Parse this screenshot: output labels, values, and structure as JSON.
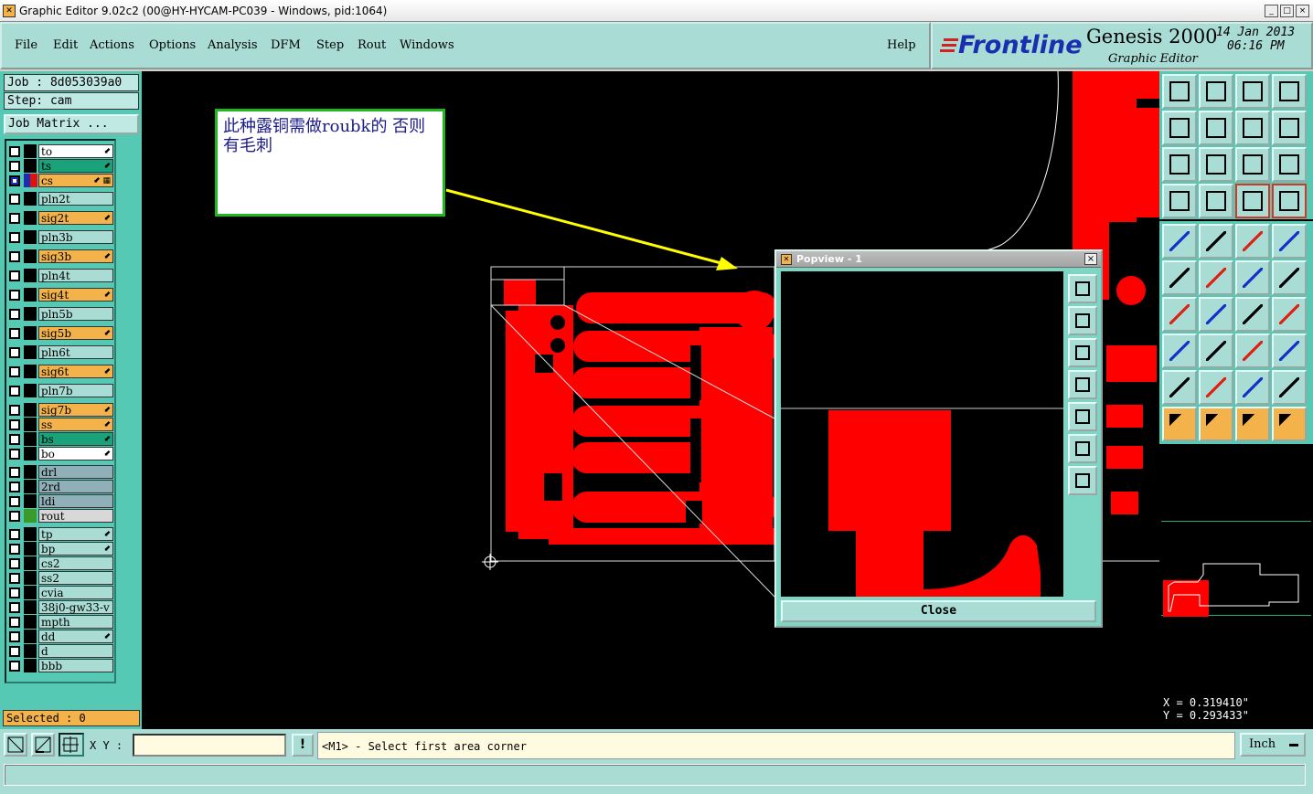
{
  "window": {
    "title": "Graphic Editor 9.02c2 (00@HY-HYCAM-PC039 - Windows, pid:1064)",
    "min": "_",
    "max": "□",
    "close": "×"
  },
  "menu": [
    "File",
    "Edit",
    "Actions",
    "Options",
    "Analysis",
    "DFM",
    "Step",
    "Rout",
    "Windows"
  ],
  "help": "Help",
  "brand": {
    "logo": "Frontline",
    "product": "Genesis 2000",
    "subtitle": "Graphic Editor",
    "date": "14 Jan 2013",
    "time": "06:16 PM"
  },
  "job": {
    "job": "Job : 8d053039a0",
    "step": "Step: cam",
    "matrix": "Job Matrix ..."
  },
  "layers": [
    {
      "name": "to",
      "bg": "#ffffff",
      "sw": "#000000",
      "mark": "⬋"
    },
    {
      "name": "ts",
      "bg": "#1aa37a",
      "sw": "#000000",
      "mark": "⬋"
    },
    {
      "name": "cs",
      "bg": "#f3b34a",
      "sw": "#e01010",
      "mark": "⬋ ▦",
      "sel": true
    },
    {
      "name": "pln2t",
      "bg": "#a8dcd4",
      "sw": "#000000",
      "mark": ""
    },
    {
      "name": "sig2t",
      "bg": "#f3b34a",
      "sw": "#000000",
      "mark": "⬋"
    },
    {
      "name": "pln3b",
      "bg": "#a8dcd4",
      "sw": "#000000",
      "mark": ""
    },
    {
      "name": "sig3b",
      "bg": "#f3b34a",
      "sw": "#000000",
      "mark": "⬋"
    },
    {
      "name": "pln4t",
      "bg": "#a8dcd4",
      "sw": "#000000",
      "mark": ""
    },
    {
      "name": "sig4t",
      "bg": "#f3b34a",
      "sw": "#000000",
      "mark": "⬋"
    },
    {
      "name": "pln5b",
      "bg": "#a8dcd4",
      "sw": "#000000",
      "mark": ""
    },
    {
      "name": "sig5b",
      "bg": "#f3b34a",
      "sw": "#000000",
      "mark": "⬋"
    },
    {
      "name": "pln6t",
      "bg": "#a8dcd4",
      "sw": "#000000",
      "mark": ""
    },
    {
      "name": "sig6t",
      "bg": "#f3b34a",
      "sw": "#000000",
      "mark": "⬋"
    },
    {
      "name": "pln7b",
      "bg": "#a8dcd4",
      "sw": "#000000",
      "mark": ""
    },
    {
      "name": "sig7b",
      "bg": "#f3b34a",
      "sw": "#000000",
      "mark": "⬋"
    },
    {
      "name": "ss",
      "bg": "#f3b34a",
      "sw": "#000000",
      "mark": "⬋"
    },
    {
      "name": "bs",
      "bg": "#1aa37a",
      "sw": "#000000",
      "mark": "⬋"
    },
    {
      "name": "bo",
      "bg": "#ffffff",
      "sw": "#000000",
      "mark": "⬋"
    },
    {
      "name": "drl",
      "bg": "#8fb0b8",
      "sw": "#000000",
      "mark": ""
    },
    {
      "name": "2rd",
      "bg": "#8fb0b8",
      "sw": "#000000",
      "mark": ""
    },
    {
      "name": "ldi",
      "bg": "#8fb0b8",
      "sw": "#000000",
      "mark": ""
    },
    {
      "name": "rout",
      "bg": "#d8d8d8",
      "sw": "#3a9a2a",
      "mark": ""
    },
    {
      "name": "tp",
      "bg": "#a8dcd4",
      "sw": "#000000",
      "mark": "⬋"
    },
    {
      "name": "bp",
      "bg": "#a8dcd4",
      "sw": "#000000",
      "mark": "⬋"
    },
    {
      "name": "cs2",
      "bg": "#a8dcd4",
      "sw": "#000000",
      "mark": ""
    },
    {
      "name": "ss2",
      "bg": "#a8dcd4",
      "sw": "#000000",
      "mark": ""
    },
    {
      "name": "cvia",
      "bg": "#a8dcd4",
      "sw": "#000000",
      "mark": ""
    },
    {
      "name": "38j0-gw33-v",
      "bg": "#a8dcd4",
      "sw": "#000000",
      "mark": ""
    },
    {
      "name": "mpth",
      "bg": "#a8dcd4",
      "sw": "#000000",
      "mark": ""
    },
    {
      "name": "dd",
      "bg": "#a8dcd4",
      "sw": "#000000",
      "mark": "⬋"
    },
    {
      "name": "d",
      "bg": "#a8dcd4",
      "sw": "#000000",
      "mark": ""
    },
    {
      "name": "bbb",
      "bg": "#a8dcd4",
      "sw": "#000000",
      "mark": ""
    }
  ],
  "selected": "Selected : 0",
  "annotation": "此种露铜需做roubk的 否则有毛刺",
  "popview": {
    "title": "Popview - 1",
    "close": "Close"
  },
  "coords": {
    "x": "X = 0.319410\"",
    "y": "Y = 0.293433\""
  },
  "status": {
    "xy_label": "X Y :",
    "xy_value": "",
    "bang": "!",
    "prompt": "<M1> - Select first area corner",
    "units": "Inch"
  },
  "colors": {
    "accent": "#a8dcd4",
    "copper": "#ff0000",
    "panel": "#55c9b4"
  }
}
